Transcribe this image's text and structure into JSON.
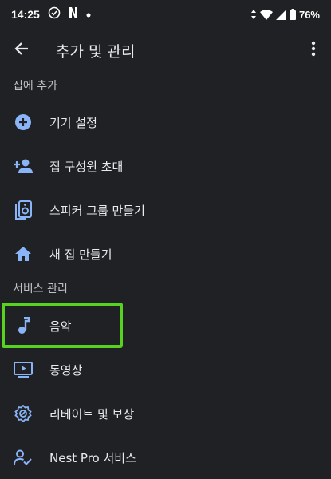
{
  "status_bar": {
    "time": "14:25",
    "battery": "76%"
  },
  "app_bar": {
    "title": "추가 및 관리"
  },
  "sections": {
    "add_to_home": "집에 추가",
    "manage_services": "서비스 관리"
  },
  "items": {
    "device_setup": "기기 설정",
    "invite_member": "집 구성원 초대",
    "speaker_group": "스피커 그룹 만들기",
    "new_home": "새 집 만들기",
    "music": "음악",
    "video": "동영상",
    "rebates": "리베이트 및 보상",
    "nest_pro": "Nest Pro 서비스"
  },
  "colors": {
    "background": "#202124",
    "icon_blue": "#8ab4f8",
    "highlight": "#57d31f"
  }
}
